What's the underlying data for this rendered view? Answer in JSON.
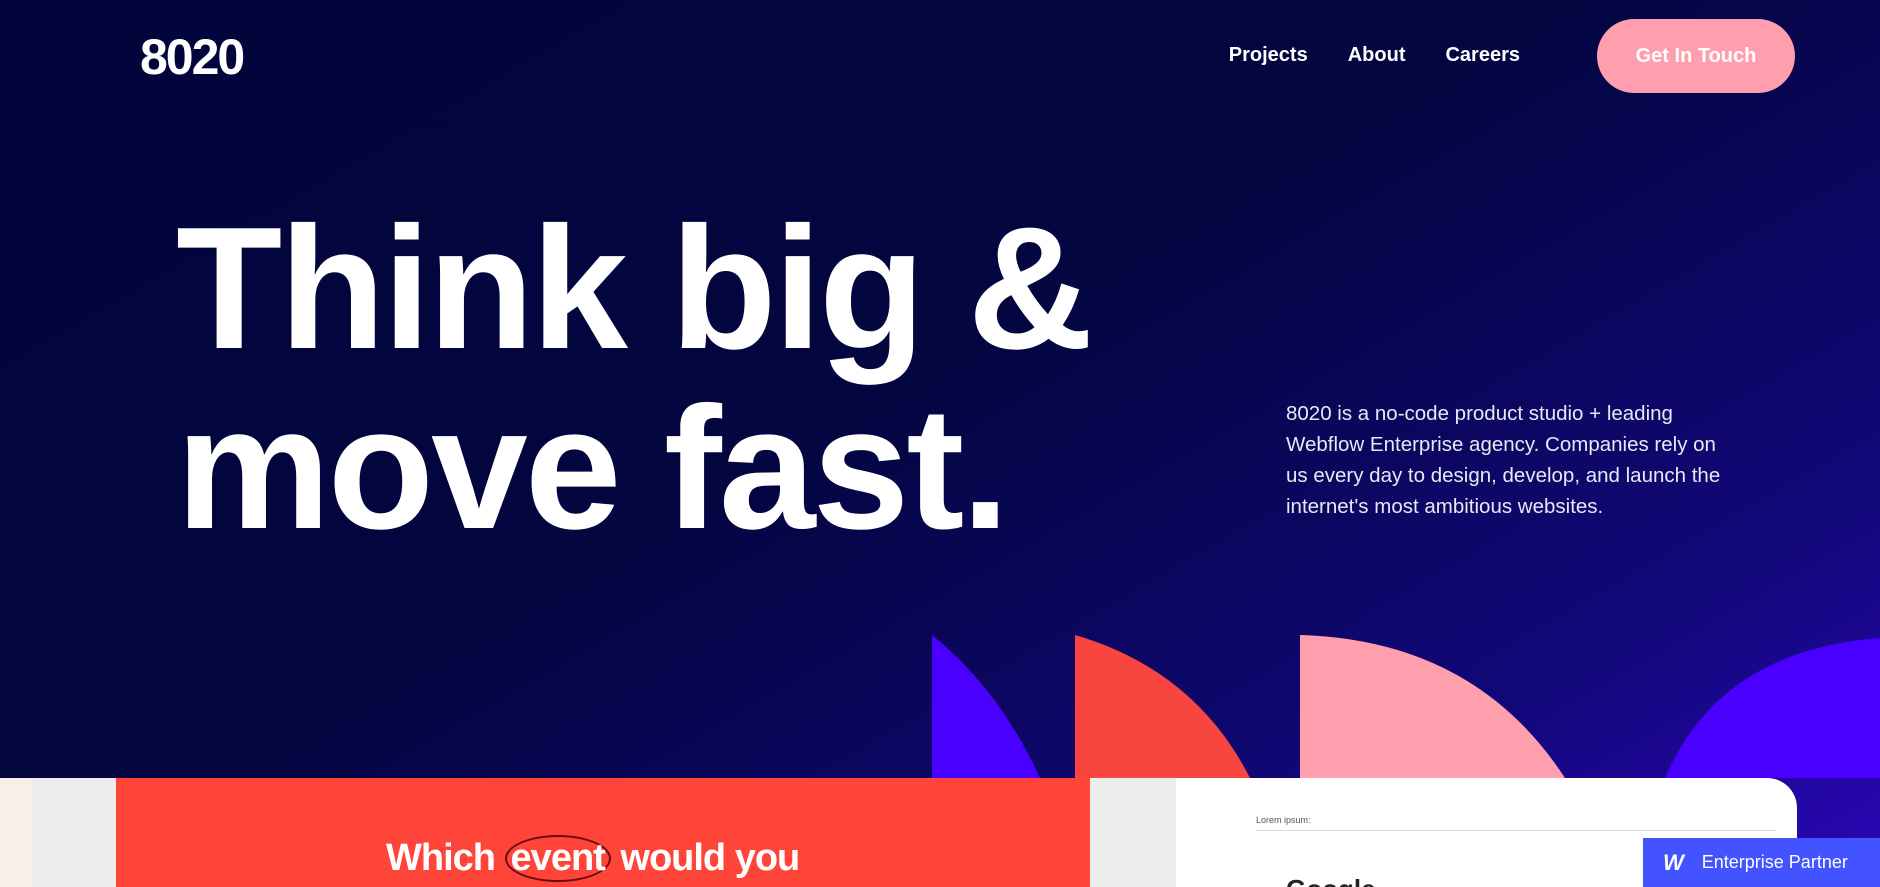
{
  "header": {
    "logo": "8020",
    "nav": [
      "Projects",
      "About",
      "Careers"
    ],
    "cta": "Get In Touch"
  },
  "hero": {
    "title_line1": "Think big &",
    "title_line2": "move fast.",
    "description": "8020 is a no-code product studio + leading Webflow Enterprise agency. Companies rely on us every day to design, develop, and launch the internet's most ambitious websites."
  },
  "preview": {
    "question_pre": "Which",
    "question_highlight": "event",
    "question_post": "would you",
    "card_label": "Lorem ipsum:",
    "card_logos": "Google"
  },
  "badge": {
    "icon": "webflow-w-icon",
    "label": "Enterprise Partner"
  },
  "colors": {
    "background": "#02053b",
    "accent_pink": "#ff9fae",
    "accent_red": "#ff453a",
    "accent_purple": "#4a00ff",
    "badge": "#4353ff"
  }
}
